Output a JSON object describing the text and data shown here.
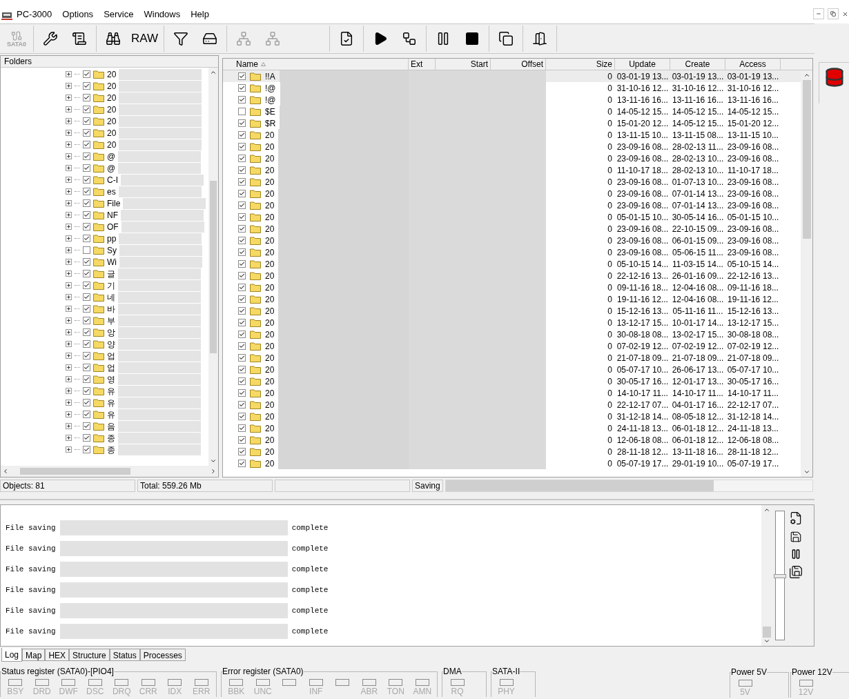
{
  "window": {
    "title": "PC-3000"
  },
  "menu": [
    "Options",
    "Service",
    "Windows",
    "Help"
  ],
  "toolbar": [
    {
      "items": [
        {
          "kind": "sata",
          "label": "SATA0",
          "disabled": true
        }
      ]
    },
    {
      "items": [
        {
          "kind": "tools",
          "disabled": false
        },
        {
          "kind": "info",
          "disabled": false
        }
      ]
    },
    {
      "items": [
        {
          "kind": "binoculars",
          "disabled": false
        },
        {
          "kind": "raw",
          "label": "RAW",
          "disabled": false
        }
      ]
    },
    {
      "items": [
        {
          "kind": "filter",
          "disabled": false
        },
        {
          "kind": "disk",
          "disabled": false
        }
      ]
    },
    {
      "items": [
        {
          "kind": "tree",
          "disabled": true
        },
        {
          "kind": "tree",
          "disabled": true
        }
      ]
    },
    {
      "items": [
        {
          "kind": "export",
          "disabled": false
        }
      ]
    },
    {
      "items": [
        {
          "kind": "play",
          "disabled": false
        },
        {
          "kind": "flow",
          "disabled": false
        }
      ]
    },
    {
      "items": [
        {
          "kind": "pause",
          "disabled": false
        },
        {
          "kind": "stop",
          "disabled": false
        }
      ]
    },
    {
      "items": [
        {
          "kind": "windows",
          "disabled": false
        }
      ]
    },
    {
      "items": [
        {
          "kind": "exit",
          "disabled": false
        }
      ]
    }
  ],
  "folders": {
    "title": "Folders",
    "items": [
      {
        "name": "20",
        "checked": true
      },
      {
        "name": "20",
        "checked": true
      },
      {
        "name": "20",
        "checked": true
      },
      {
        "name": "20",
        "checked": true
      },
      {
        "name": "20",
        "checked": true
      },
      {
        "name": "20",
        "checked": true
      },
      {
        "name": "20",
        "checked": true
      },
      {
        "name": "@",
        "checked": true
      },
      {
        "name": "@",
        "checked": true
      },
      {
        "name": "C-I",
        "checked": true
      },
      {
        "name": "es",
        "checked": true
      },
      {
        "name": "File",
        "checked": true
      },
      {
        "name": "NF",
        "checked": true
      },
      {
        "name": "OF",
        "checked": true
      },
      {
        "name": "pp",
        "checked": true
      },
      {
        "name": "Sy",
        "checked": false
      },
      {
        "name": "Wi",
        "checked": true
      },
      {
        "name": "글",
        "checked": true
      },
      {
        "name": "기",
        "checked": true
      },
      {
        "name": "네",
        "checked": true
      },
      {
        "name": "바",
        "checked": true
      },
      {
        "name": "부",
        "checked": true
      },
      {
        "name": "앙",
        "checked": true
      },
      {
        "name": "양",
        "checked": true
      },
      {
        "name": "업",
        "checked": true
      },
      {
        "name": "업",
        "checked": true
      },
      {
        "name": "영",
        "checked": true
      },
      {
        "name": "유",
        "checked": true
      },
      {
        "name": "유",
        "checked": true
      },
      {
        "name": "유",
        "checked": true
      },
      {
        "name": "음",
        "checked": true
      },
      {
        "name": "종",
        "checked": true
      },
      {
        "name": "종",
        "checked": true
      }
    ]
  },
  "table": {
    "columns": [
      "Name",
      "Ext",
      "Start",
      "Offset",
      "Size",
      "Update",
      "Create",
      "Access"
    ],
    "rows": [
      {
        "name": "!!A",
        "checked": true,
        "selected": true,
        "size": "0",
        "update": "03-01-19 13...",
        "create": "03-01-19 13...",
        "access": "03-01-19 13..."
      },
      {
        "name": "!@",
        "checked": true,
        "selected": false,
        "size": "0",
        "update": "31-10-16 12...",
        "create": "31-10-16 12...",
        "access": "31-10-16 12..."
      },
      {
        "name": "!@",
        "checked": true,
        "selected": false,
        "size": "0",
        "update": "13-11-16 16...",
        "create": "13-11-16 16...",
        "access": "13-11-16 16..."
      },
      {
        "name": "$E",
        "checked": false,
        "selected": false,
        "size": "0",
        "update": "14-05-12 15...",
        "create": "14-05-12 15...",
        "access": "14-05-12 15..."
      },
      {
        "name": "$R",
        "checked": true,
        "selected": false,
        "size": "0",
        "update": "15-01-20 12...",
        "create": "14-05-12 15...",
        "access": "15-01-20 12..."
      },
      {
        "name": "20",
        "checked": true,
        "selected": false,
        "size": "0",
        "update": "13-11-15 10...",
        "create": "13-11-15 08...",
        "access": "13-11-15 10..."
      },
      {
        "name": "20",
        "checked": true,
        "selected": false,
        "size": "0",
        "update": "23-09-16 08...",
        "create": "28-02-13 11...",
        "access": "23-09-16 08..."
      },
      {
        "name": "20",
        "checked": true,
        "selected": false,
        "size": "0",
        "update": "23-09-16 08...",
        "create": "28-02-13 10...",
        "access": "23-09-16 08..."
      },
      {
        "name": "20",
        "checked": true,
        "selected": false,
        "size": "0",
        "update": "11-10-17 18...",
        "create": "28-02-13 10...",
        "access": "11-10-17 18..."
      },
      {
        "name": "20",
        "checked": true,
        "selected": false,
        "size": "0",
        "update": "23-09-16 08...",
        "create": "01-07-13 10...",
        "access": "23-09-16 08..."
      },
      {
        "name": "20",
        "checked": true,
        "selected": false,
        "size": "0",
        "update": "23-09-16 08...",
        "create": "07-01-14 13...",
        "access": "23-09-16 08..."
      },
      {
        "name": "20",
        "checked": true,
        "selected": false,
        "size": "0",
        "update": "23-09-16 08...",
        "create": "07-01-14 13...",
        "access": "23-09-16 08..."
      },
      {
        "name": "20",
        "checked": true,
        "selected": false,
        "size": "0",
        "update": "05-01-15 10...",
        "create": "30-05-14 16...",
        "access": "05-01-15 10..."
      },
      {
        "name": "20",
        "checked": true,
        "selected": false,
        "size": "0",
        "update": "23-09-16 08...",
        "create": "22-10-15 09...",
        "access": "23-09-16 08..."
      },
      {
        "name": "20",
        "checked": true,
        "selected": false,
        "size": "0",
        "update": "23-09-16 08...",
        "create": "06-01-15 09...",
        "access": "23-09-16 08..."
      },
      {
        "name": "20",
        "checked": true,
        "selected": false,
        "size": "0",
        "update": "23-09-16 08...",
        "create": "05-06-15 11...",
        "access": "23-09-16 08..."
      },
      {
        "name": "20",
        "checked": true,
        "selected": false,
        "size": "0",
        "update": "05-10-15 14...",
        "create": "11-03-15 14...",
        "access": "05-10-15 14..."
      },
      {
        "name": "20",
        "checked": true,
        "selected": false,
        "size": "0",
        "update": "22-12-16 13...",
        "create": "26-01-16 09...",
        "access": "22-12-16 13..."
      },
      {
        "name": "20",
        "checked": true,
        "selected": false,
        "size": "0",
        "update": "09-11-16 18...",
        "create": "12-04-16 08...",
        "access": "09-11-16 18..."
      },
      {
        "name": "20",
        "checked": true,
        "selected": false,
        "size": "0",
        "update": "19-11-16 12...",
        "create": "12-04-16 08...",
        "access": "19-11-16 12..."
      },
      {
        "name": "20",
        "checked": true,
        "selected": false,
        "size": "0",
        "update": "15-12-16 13...",
        "create": "05-11-16 11...",
        "access": "15-12-16 13..."
      },
      {
        "name": "20",
        "checked": true,
        "selected": false,
        "size": "0",
        "update": "13-12-17 15...",
        "create": "10-01-17 14...",
        "access": "13-12-17 15..."
      },
      {
        "name": "20",
        "checked": true,
        "selected": false,
        "size": "0",
        "update": "30-08-18 08...",
        "create": "13-02-17 15...",
        "access": "30-08-18 08..."
      },
      {
        "name": "20",
        "checked": true,
        "selected": false,
        "size": "0",
        "update": "07-02-19 12...",
        "create": "07-02-19 12...",
        "access": "07-02-19 12..."
      },
      {
        "name": "20",
        "checked": true,
        "selected": false,
        "size": "0",
        "update": "21-07-18 09...",
        "create": "21-07-18 09...",
        "access": "21-07-18 09..."
      },
      {
        "name": "20",
        "checked": true,
        "selected": false,
        "size": "0",
        "update": "05-07-17 10...",
        "create": "26-06-17 13...",
        "access": "05-07-17 10..."
      },
      {
        "name": "20",
        "checked": true,
        "selected": false,
        "size": "0",
        "update": "30-05-17 16...",
        "create": "12-01-17 13...",
        "access": "30-05-17 16..."
      },
      {
        "name": "20",
        "checked": true,
        "selected": false,
        "size": "0",
        "update": "14-10-17 11...",
        "create": "14-10-17 11...",
        "access": "14-10-17 11..."
      },
      {
        "name": "20",
        "checked": true,
        "selected": false,
        "size": "0",
        "update": "22-12-17 07...",
        "create": "04-01-17 16...",
        "access": "22-12-17 07..."
      },
      {
        "name": "20",
        "checked": true,
        "selected": false,
        "size": "0",
        "update": "31-12-18 14...",
        "create": "08-05-18 12...",
        "access": "31-12-18 14..."
      },
      {
        "name": "20",
        "checked": true,
        "selected": false,
        "size": "0",
        "update": "24-11-18 13...",
        "create": "06-01-18 12...",
        "access": "24-11-18 13..."
      },
      {
        "name": "20",
        "checked": true,
        "selected": false,
        "size": "0",
        "update": "12-06-18 08...",
        "create": "06-01-18 12...",
        "access": "12-06-18 08..."
      },
      {
        "name": "20",
        "checked": true,
        "selected": false,
        "size": "0",
        "update": "28-11-18 12...",
        "create": "13-11-18 16...",
        "access": "28-11-18 12..."
      },
      {
        "name": "20",
        "checked": true,
        "selected": false,
        "size": "0",
        "update": "05-07-19 17...",
        "create": "29-01-19 10...",
        "access": "05-07-19 17..."
      }
    ]
  },
  "status_bar": {
    "objects": "Objects: 81",
    "total": "Total: 559.26 Mb",
    "progress_label": "Saving",
    "level": 0.73
  },
  "log": {
    "lines": [
      {
        "action": "File saving",
        "result": "complete"
      },
      {
        "action": "File saving",
        "result": "complete"
      },
      {
        "action": "File saving",
        "result": "complete"
      },
      {
        "action": "File saving",
        "result": "complete"
      },
      {
        "action": "File saving",
        "result": "complete"
      },
      {
        "action": "File saving",
        "result": "complete"
      }
    ],
    "slider": {
      "level": 0.5
    }
  },
  "log_tabs": [
    {
      "label": "Log",
      "selected": true
    },
    {
      "label": "Map",
      "selected": false
    },
    {
      "label": "HEX",
      "selected": false
    },
    {
      "label": "Structure",
      "selected": false
    },
    {
      "label": "Status",
      "selected": false
    },
    {
      "label": "Processes",
      "selected": false
    }
  ],
  "registers": [
    {
      "title": "Status register (SATA0)-[PIO4]",
      "leds": [
        {
          "kind": "labeled",
          "label": "BSY"
        },
        {
          "kind": "labeled",
          "label": "DRD"
        },
        {
          "kind": "labeled",
          "label": "DWF"
        },
        {
          "kind": "labeled",
          "label": "DSC"
        },
        {
          "kind": "labeled",
          "label": "DRQ"
        },
        {
          "kind": "labeled",
          "label": "CRR"
        },
        {
          "kind": "labeled",
          "label": "IDX"
        },
        {
          "kind": "labeled",
          "label": "ERR"
        }
      ]
    },
    {
      "title": "Error register (SATA0)",
      "leds": [
        {
          "kind": "labeled",
          "label": "BBK"
        },
        {
          "kind": "labeled",
          "label": "UNC"
        },
        {
          "kind": "blank"
        },
        {
          "kind": "labeled",
          "label": "INF"
        },
        {
          "kind": "blank"
        },
        {
          "kind": "labeled",
          "label": "ABR"
        },
        {
          "kind": "labeled",
          "label": "TON"
        },
        {
          "kind": "labeled",
          "label": "AMN"
        }
      ]
    },
    {
      "title": "DMA",
      "leds": [
        {
          "kind": "labeled",
          "label": "RQ"
        }
      ]
    },
    {
      "title": "SATA-II",
      "leds": [
        {
          "kind": "labeled",
          "label": "PHY"
        }
      ]
    }
  ],
  "power": [
    {
      "title": "Power 5V",
      "leds": [
        {
          "kind": "labeled",
          "label": "5V"
        }
      ]
    },
    {
      "title": "Power 12V",
      "leds": [
        {
          "kind": "labeled",
          "label": "12V"
        }
      ]
    }
  ]
}
